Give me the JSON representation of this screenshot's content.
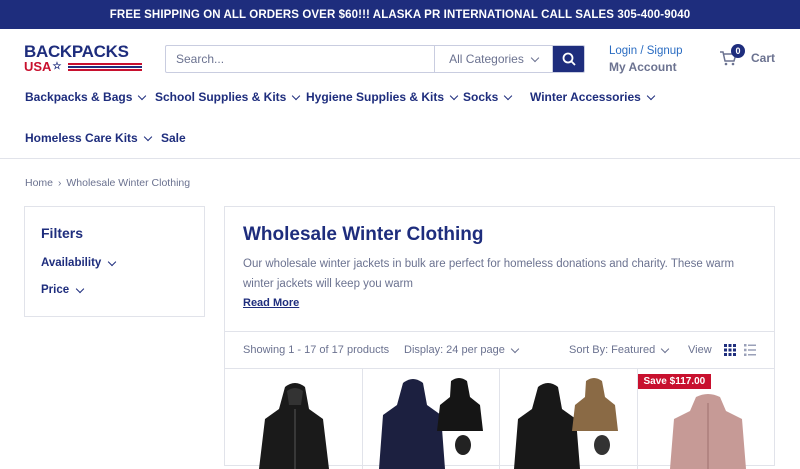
{
  "announcement": "FREE SHIPPING ON ALL ORDERS OVER $60!!! ALASKA PR INTERNATIONAL CALL SALES 305-400-9040",
  "logo": {
    "line1": "BACKPACKS",
    "line2": "USA"
  },
  "search": {
    "placeholder": "Search...",
    "category": "All Categories"
  },
  "account": {
    "login": "Login / Signup",
    "my_account": "My Account"
  },
  "cart": {
    "count": "0",
    "label": "Cart"
  },
  "nav": [
    "Backpacks & Bags",
    "School Supplies & Kits",
    "Hygiene Supplies & Kits",
    "Socks",
    "Winter Accessories",
    "Homeless Care Kits",
    "Sale"
  ],
  "breadcrumb": {
    "home": "Home",
    "current": "Wholesale Winter Clothing"
  },
  "filters": {
    "title": "Filters",
    "options": [
      "Availability",
      "Price"
    ]
  },
  "collection": {
    "title": "Wholesale Winter Clothing",
    "description": "Our wholesale winter jackets in bulk are perfect for homeless donations and charity. These warm winter jackets will keep you warm",
    "read_more": "Read More"
  },
  "toolbar": {
    "showing": "Showing 1 - 17 of 17 products",
    "display": "Display: 24 per page",
    "sort": "Sort By: Featured",
    "view": "View"
  },
  "products": [
    {
      "badge": ""
    },
    {
      "badge": ""
    },
    {
      "badge": ""
    },
    {
      "badge": "Save $117.00"
    }
  ],
  "colors": {
    "brand": "#1e2d7d",
    "sale": "#c8102e",
    "link": "#2a6cc2"
  }
}
